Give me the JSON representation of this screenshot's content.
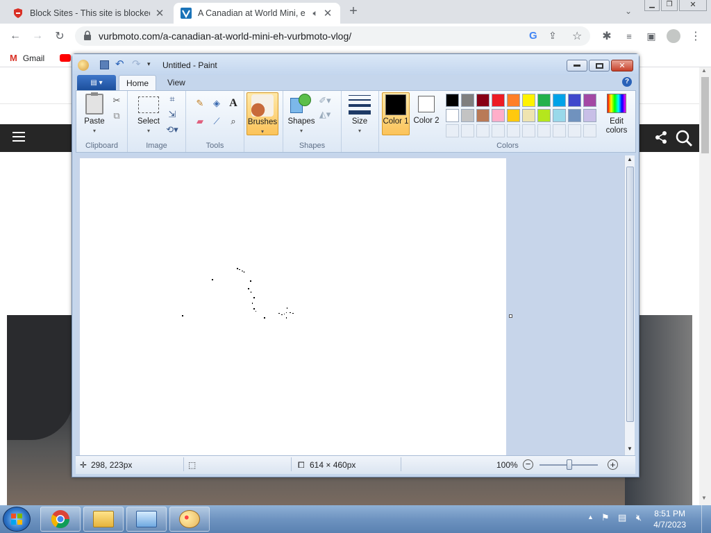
{
  "browser": {
    "tabs": [
      {
        "title": "Block Sites - This site is blocked",
        "active": false
      },
      {
        "title": "A Canadian at World Mini, e",
        "active": true
      }
    ],
    "url": "vurbmoto.com/a-canadian-at-world-mini-eh-vurbmoto-vlog/",
    "bookmarks": [
      {
        "label": "Gmail"
      }
    ]
  },
  "paint": {
    "title": "Untitled - Paint",
    "tabs": [
      "Home",
      "View"
    ],
    "groups": {
      "clipboard": {
        "label": "Clipboard",
        "paste": "Paste"
      },
      "image": {
        "label": "Image",
        "select": "Select"
      },
      "tools": {
        "label": "Tools"
      },
      "brushes": {
        "label": "Brushes"
      },
      "shapes": {
        "label": "Shapes",
        "shapes_btn": "Shapes"
      },
      "size": {
        "label": "Size"
      },
      "colors": {
        "label": "Colors",
        "color1": "Color 1",
        "color2": "Color 2",
        "edit": "Edit colors",
        "color1_value": "#000000",
        "color2_value": "#ffffff",
        "palette_row1": [
          "#000000",
          "#7f7f7f",
          "#880015",
          "#ed1c24",
          "#ff7f27",
          "#fff200",
          "#22b14c",
          "#00a2e8",
          "#3f48cc",
          "#a349a4"
        ],
        "palette_row2": [
          "#ffffff",
          "#c3c3c3",
          "#b97a57",
          "#ffaec9",
          "#ffc90e",
          "#efe4b0",
          "#b5e61d",
          "#99d9ea",
          "#7092be",
          "#c8bfe7"
        ]
      }
    },
    "status": {
      "cursor": "298, 223px",
      "canvas_size": "614 × 460px",
      "zoom": "100%"
    }
  },
  "taskbar": {
    "time": "8:51 PM",
    "date": "4/7/2023"
  }
}
